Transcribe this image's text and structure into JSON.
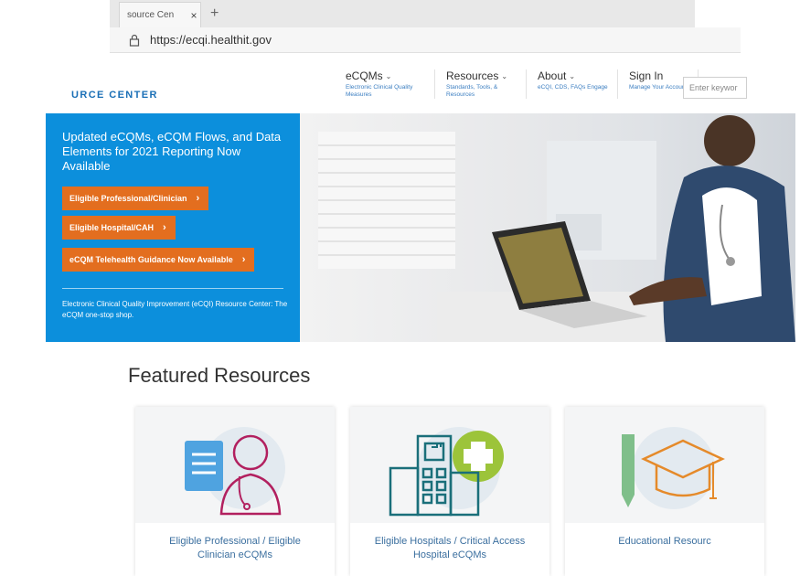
{
  "browser": {
    "tab_title": "source Cen",
    "tab_close": "×",
    "new_tab": "+",
    "url": "https://ecqi.healthit.gov"
  },
  "header": {
    "brand": "URCE CENTER",
    "nav": [
      {
        "title": "eCQMs",
        "sub": "Electronic Clinical Quality Measures"
      },
      {
        "title": "Resources",
        "sub": "Standards, Tools, & Resources"
      },
      {
        "title": "About",
        "sub": "eCQI, CDS, FAQs Engage"
      },
      {
        "title": "Sign In",
        "sub": "Manage Your Account"
      }
    ],
    "search_placeholder": "Enter keywor"
  },
  "hero": {
    "title": "Updated eCQMs, eCQM Flows, and Data Elements for 2021 Reporting Now Available",
    "buttons": [
      "Eligible Professional/Clinician",
      "Eligible Hospital/CAH",
      "eCQM Telehealth Guidance Now Available"
    ],
    "tagline": "Electronic Clinical Quality Improvement (eCQI) Resource Center: The eCQM one-stop shop."
  },
  "featured": {
    "title": "Featured Resources",
    "cards": [
      {
        "label": "Eligible Professional / Eligible Clinician eCQMs",
        "icon": "doctor-icon"
      },
      {
        "label": "Eligible Hospitals / Critical Access Hospital eCQMs",
        "icon": "hospital-icon"
      },
      {
        "label": "Educational Resourc",
        "icon": "graduation-cap-icon"
      }
    ]
  },
  "colors": {
    "hero_blue": "#0c8fdc",
    "cta_orange": "#e36e1f",
    "link_blue": "#3b6f9f"
  }
}
